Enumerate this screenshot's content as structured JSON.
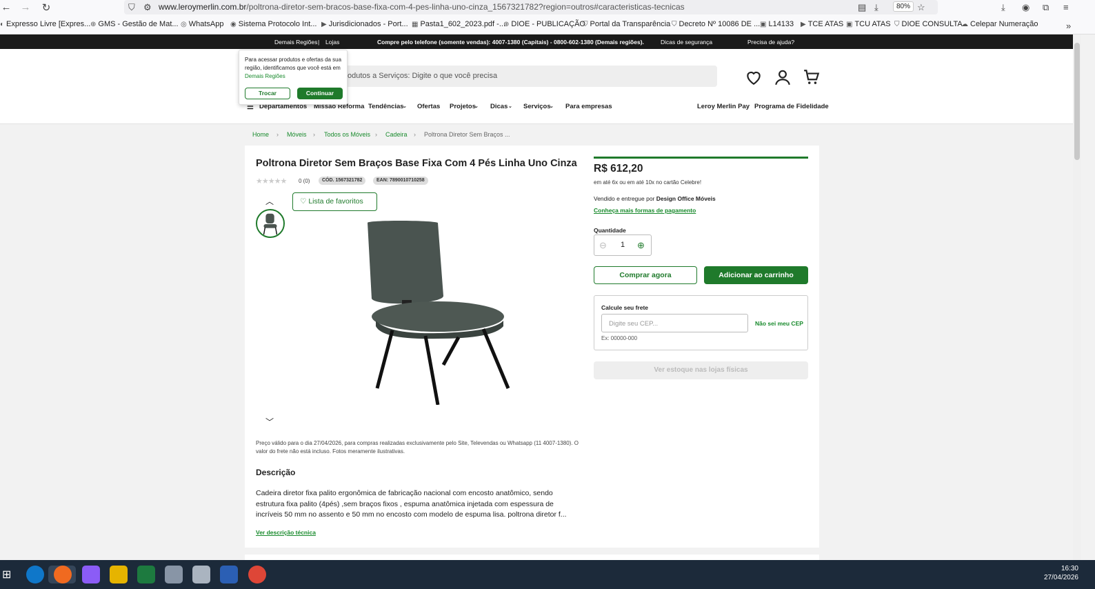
{
  "browser": {
    "url_domain": "www.leroymerlin.com.br",
    "url_path": "/poltrona-diretor-sem-bracos-base-fixa-com-4-pes-linha-uno-cinza_1567321782?region=outros#caracteristicas-tecnicas",
    "zoom": "80%",
    "bookmarks": [
      "Expresso Livre [Expres...",
      "GMS - Gestão de Mat...",
      "WhatsApp",
      "Sistema Protocolo Int...",
      "Jurisdicionados - Port...",
      "Pasta1_602_2023.pdf -...",
      "DIOE - PUBLICAÇÃO",
      "Portal da Transparência",
      "Decreto Nº 10086 DE ...",
      "L14133",
      "TCE ATAS",
      "TCU ATAS",
      "DIOE CONSULTA",
      "Celepar Numeração"
    ]
  },
  "topbar": {
    "region": "Demais Regiões",
    "separator": "|",
    "stores": "Lojas",
    "phone": "Compre pelo telefone (somente vendas): 4007-1380 (Capitais) - 0800-602-1380 (Demais regiões).",
    "security": "Dicas de segurança",
    "help": "Precisa de ajuda?"
  },
  "header": {
    "search_placeholder": "odutos a Serviços: Digite o que você precisa",
    "menu": [
      "Departamentos",
      "Missão Reforma",
      "Tendências",
      "Ofertas",
      "Projetos",
      "Dicas",
      "Serviços",
      "Para empresas"
    ],
    "menu_right": [
      "Leroy Merlin Pay",
      "Programa de Fidelidade"
    ]
  },
  "popup": {
    "text": "Para acessar produtos e ofertas da sua região, identificamos que você está em",
    "region_link": "Demais Regiões",
    "change": "Trocar",
    "continue": "Continuar"
  },
  "breadcrumb": [
    "Home",
    "Móveis",
    "Todos os Móveis",
    "Cadeira",
    "Poltrona Diretor Sem Braços ..."
  ],
  "product": {
    "title": "Poltrona Diretor Sem Braços Base Fixa Com 4 Pés Linha Uno Cinza",
    "rating": "0 (0)",
    "code": "CÓD. 1567321782",
    "ean": "EAN: 7890010710258",
    "favorites": "Lista de favoritos",
    "price": "R$ 612,20",
    "installments": "em até 6x ou em até 10x no cartão Celebre!",
    "seller_prefix": "Vendido e entregue por",
    "seller": "Design Office Móveis",
    "payment_link": "Conheça mais formas de pagamento",
    "quantity_label": "Quantidade",
    "quantity": "1",
    "buy_now": "Comprar agora",
    "add_cart": "Adicionar ao carrinho",
    "freight_label": "Calcule seu frete",
    "cep_placeholder": "Digite seu CEP...",
    "cep_link": "Não sei meu CEP",
    "cep_example": "Ex: 00000-000",
    "stock": "Ver estoque nas lojas físicas",
    "validity": "Preço válido para o dia 27/04/2026, para compras realizadas exclusivamente pelo Site, Televendas ou Whatsapp (11 4007-1380). O valor do frete não está incluso. Fotos meramente ilustrativas.",
    "description_heading": "Descrição",
    "description": "Cadeira diretor fixa palito ergonômica de fabricação nacional com encosto anatômico, sendo estrutura fixa palito (4pés) ,sem braços fixos , espuma anatômica injetada com espessura de incríveis 50 mm no assento e 50 mm no encosto com modelo de espuma lisa.  poltrona diretor f...",
    "tech_link": "Ver descrição técnica"
  },
  "taskbar": {
    "time": "16:30",
    "date": "27/04/2026"
  },
  "colors": {
    "brand": "#1f7a2b",
    "topbar": "#1a1a1a"
  }
}
